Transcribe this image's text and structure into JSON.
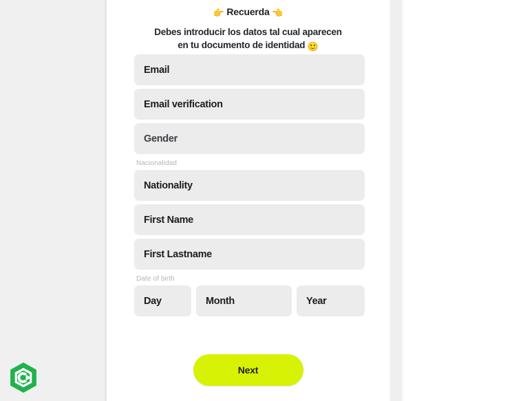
{
  "header": {
    "remember_emoji_left": "👉",
    "remember_title": "Recuerda",
    "remember_emoji_right": "👈",
    "instruction_line1": "Debes introducir los datos tal cual aparecen",
    "instruction_line2": "en tu documento de identidad",
    "instruction_emoji": "🙂"
  },
  "form": {
    "fields": [
      {
        "label": "Email"
      },
      {
        "label": "Email verification"
      },
      {
        "label": "Gender"
      },
      {
        "label": "Nationality"
      },
      {
        "label": "First Name"
      },
      {
        "label": "First Lastname"
      }
    ],
    "nationality_group_label": "Nacionalidad",
    "dob_group_label": "Date of birth",
    "dob": {
      "day": "Day",
      "month": "Month",
      "year": "Year"
    }
  },
  "actions": {
    "next_label": "Next"
  },
  "branding": {
    "logo_letter": "C",
    "logo_color": "#22b24c",
    "accent_color": "#d7f205"
  }
}
